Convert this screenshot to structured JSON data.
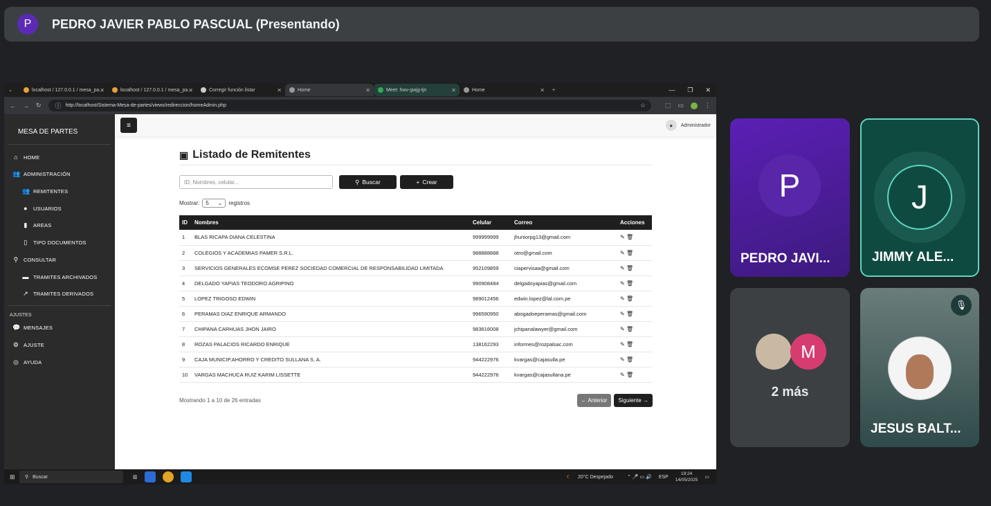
{
  "meet": {
    "presenter_initial": "P",
    "presenter_title": "PEDRO JAVIER PABLO PASCUAL (Presentando)",
    "tiles": [
      {
        "initial": "P",
        "name": "PEDRO JAVI..."
      },
      {
        "initial": "J",
        "name": "JIMMY ALE..."
      },
      {
        "more": "2 más",
        "initial2": "M"
      },
      {
        "name": "JESUS BALT...",
        "muted_icon": "mic-off-icon"
      }
    ]
  },
  "browser": {
    "tabs": [
      {
        "label": "localhost / 127.0.0.1 / mesa_pa..."
      },
      {
        "label": "localhost / 127.0.0.1 / mesa_pa..."
      },
      {
        "label": "Corregir función listar"
      },
      {
        "label": "Home"
      },
      {
        "label": "Meet: hwv-gwjg-tjn"
      },
      {
        "label": "Home"
      }
    ],
    "url": "http://localhost/Sistema-Mesa-de-partes/views/redireccion/homeAdmin.php"
  },
  "sidebar": {
    "title": "MESA DE PARTES",
    "items": [
      {
        "label": "HOME"
      },
      {
        "label": "ADMINISTRACIÓN"
      },
      {
        "label": "REMITENTES"
      },
      {
        "label": "USUARIOS"
      },
      {
        "label": "AREAS"
      },
      {
        "label": "TIPO DOCUMENTOS"
      },
      {
        "label": "CONSULTAR"
      },
      {
        "label": "TRAMITES ARCHIVADOS"
      },
      {
        "label": "TRAMITES DERIVADOS"
      }
    ],
    "section2": "AJUSTES",
    "items2": [
      {
        "label": "MENSAJES"
      },
      {
        "label": "AJUSTE"
      },
      {
        "label": "AYUDA"
      }
    ]
  },
  "navbar": {
    "menu_icon": "≡",
    "user": "Administrador"
  },
  "page": {
    "title": "Listado de Remitentes",
    "search_placeholder": "ID, Nombres, celular...",
    "search_btn": "Buscar",
    "create_btn": "Crear",
    "show_label": "Mostrar:",
    "show_value": "5",
    "show_suffix": "registros",
    "columns": [
      "ID",
      "Nombres",
      "Celular",
      "Correo",
      "Acciones"
    ],
    "rows": [
      {
        "id": "1",
        "nombre": "BLAS RICAPA DIANA CELESTINA",
        "cel": "999999999",
        "correo": "jhuniorpg13@gmail.com"
      },
      {
        "id": "2",
        "nombre": "COLEGIOS Y ACADEMIAS PAMER S.R.L.",
        "cel": "988888888",
        "correo": "otro@gmail.com"
      },
      {
        "id": "3",
        "nombre": "SERVICIOS GENERALES ECOMSE PEREZ SOCIEDAD COMERCIAL DE RESPONSABILIDAD LIMITADA",
        "cel": "952109859",
        "correo": "ciapervisaa@gmail.com"
      },
      {
        "id": "4",
        "nombre": "DELGADO YAPIAS TEODORO AGRIPINO",
        "cel": "990908484",
        "correo": "delgadoyapias@gmail.com"
      },
      {
        "id": "5",
        "nombre": "LOPEZ TRIGOSO EDWIN",
        "cel": "989012456",
        "correo": "edwin.lopez@lal.com.pe"
      },
      {
        "id": "6",
        "nombre": "PERAMAS DIAZ ENRIQUE ARMANDO",
        "cel": "996590950",
        "correo": "abogadoeperamas@gmail.com"
      },
      {
        "id": "7",
        "nombre": "CHIPANA CARHUAS JHON JAIRO",
        "cel": "983616008",
        "correo": "jchipanalawyer@gmail.com"
      },
      {
        "id": "8",
        "nombre": "ROZAS PALACIOS RICARDO ENRIQUE",
        "cel": "138162293",
        "correo": "informes@rozpalsac.com"
      },
      {
        "id": "9",
        "nombre": "CAJA MUNICIP.AHORRO Y CREDITO SULLANA S. A.",
        "cel": "944222976",
        "correo": "kvargas@cajasulla.pe"
      },
      {
        "id": "10",
        "nombre": "VARGAS MACHUCA RUIZ KARIM LISSETTE",
        "cel": "944222976",
        "correo": "kvargas@cajasullana.pe"
      }
    ],
    "footer": "Mostrando 1 a 10 de 26 entradas",
    "prev": "← Anterior",
    "next": "Siguiente →"
  },
  "taskbar": {
    "search": "Buscar",
    "weather": "20°C  Despejado",
    "lang": "ESP",
    "time": "19:24",
    "date": "14/05/2025"
  }
}
